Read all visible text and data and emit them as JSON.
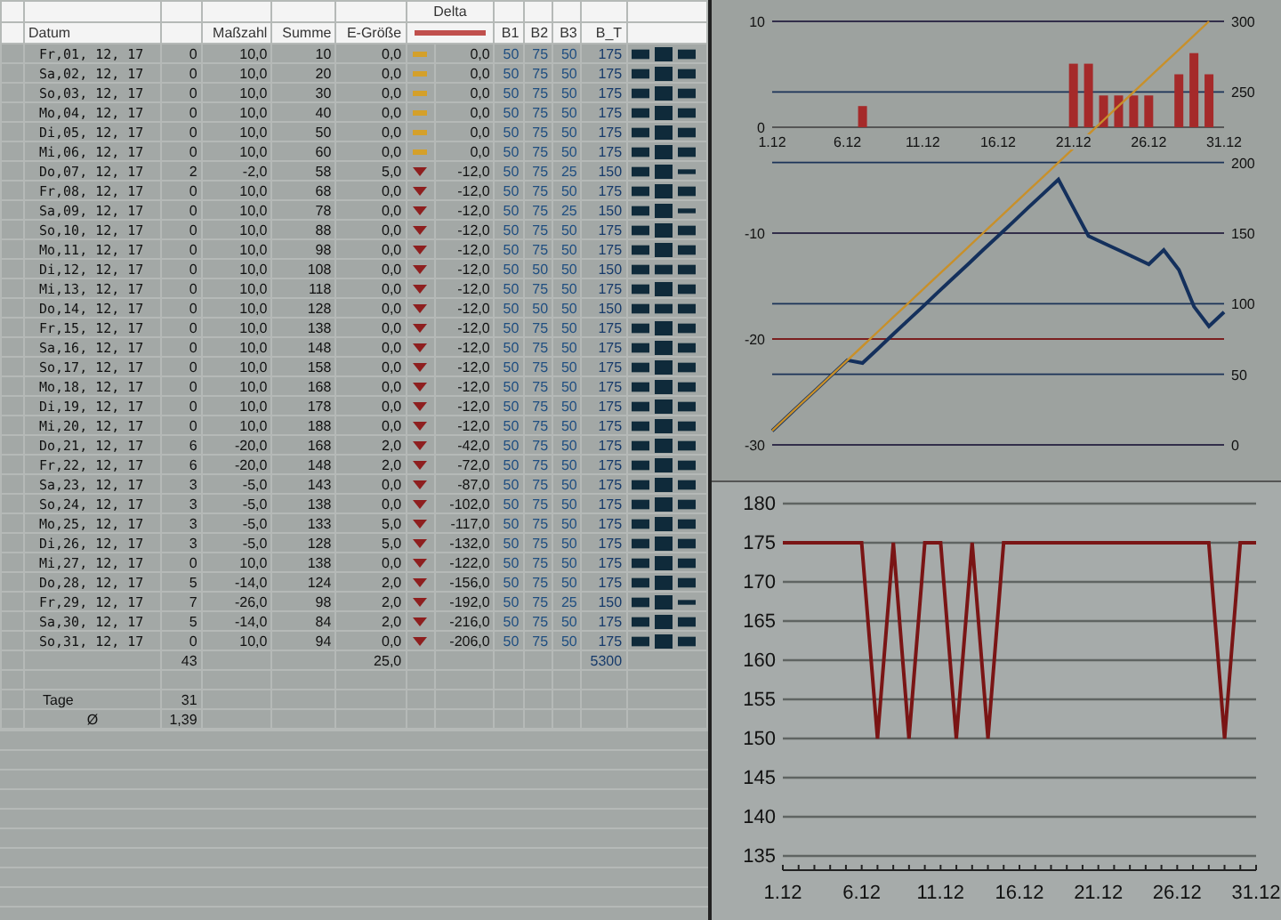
{
  "table": {
    "group_label": "Delta",
    "columns": [
      "Datum",
      "Maßzahl",
      "Summe",
      "E-Größe",
      "B1",
      "B2",
      "B3",
      "B_T"
    ],
    "rows": [
      {
        "datum": "Fr,01, 12, 17",
        "column_2": "0",
        "masszahl": "10,0",
        "summe": "10",
        "e_groesse": "0,0",
        "kind": "flat",
        "delta": "0,0",
        "b1": "50",
        "b2": "75",
        "b3": "50",
        "b_t": "175"
      },
      {
        "datum": "Sa,02, 12, 17",
        "column_2": "0",
        "masszahl": "10,0",
        "summe": "20",
        "e_groesse": "0,0",
        "kind": "flat",
        "delta": "0,0",
        "b1": "50",
        "b2": "75",
        "b3": "50",
        "b_t": "175"
      },
      {
        "datum": "So,03, 12, 17",
        "column_2": "0",
        "masszahl": "10,0",
        "summe": "30",
        "e_groesse": "0,0",
        "kind": "flat",
        "delta": "0,0",
        "b1": "50",
        "b2": "75",
        "b3": "50",
        "b_t": "175"
      },
      {
        "datum": "Mo,04, 12, 17",
        "column_2": "0",
        "masszahl": "10,0",
        "summe": "40",
        "e_groesse": "0,0",
        "kind": "flat",
        "delta": "0,0",
        "b1": "50",
        "b2": "75",
        "b3": "50",
        "b_t": "175"
      },
      {
        "datum": "Di,05, 12, 17",
        "column_2": "0",
        "masszahl": "10,0",
        "summe": "50",
        "e_groesse": "0,0",
        "kind": "flat",
        "delta": "0,0",
        "b1": "50",
        "b2": "75",
        "b3": "50",
        "b_t": "175"
      },
      {
        "datum": "Mi,06, 12, 17",
        "column_2": "0",
        "masszahl": "10,0",
        "summe": "60",
        "e_groesse": "0,0",
        "kind": "flat",
        "delta": "0,0",
        "b1": "50",
        "b2": "75",
        "b3": "50",
        "b_t": "175"
      },
      {
        "datum": "Do,07, 12, 17",
        "column_2": "2",
        "masszahl": "-2,0",
        "summe": "58",
        "e_groesse": "5,0",
        "kind": "down",
        "delta": "-12,0",
        "b1": "50",
        "b2": "75",
        "b3": "25",
        "b_t": "150"
      },
      {
        "datum": "Fr,08, 12, 17",
        "column_2": "0",
        "masszahl": "10,0",
        "summe": "68",
        "e_groesse": "0,0",
        "kind": "down",
        "delta": "-12,0",
        "b1": "50",
        "b2": "75",
        "b3": "50",
        "b_t": "175"
      },
      {
        "datum": "Sa,09, 12, 17",
        "column_2": "0",
        "masszahl": "10,0",
        "summe": "78",
        "e_groesse": "0,0",
        "kind": "down",
        "delta": "-12,0",
        "b1": "50",
        "b2": "75",
        "b3": "25",
        "b_t": "150"
      },
      {
        "datum": "So,10, 12, 17",
        "column_2": "0",
        "masszahl": "10,0",
        "summe": "88",
        "e_groesse": "0,0",
        "kind": "down",
        "delta": "-12,0",
        "b1": "50",
        "b2": "75",
        "b3": "50",
        "b_t": "175"
      },
      {
        "datum": "Mo,11, 12, 17",
        "column_2": "0",
        "masszahl": "10,0",
        "summe": "98",
        "e_groesse": "0,0",
        "kind": "down",
        "delta": "-12,0",
        "b1": "50",
        "b2": "75",
        "b3": "50",
        "b_t": "175"
      },
      {
        "datum": "Di,12, 12, 17",
        "column_2": "0",
        "masszahl": "10,0",
        "summe": "108",
        "e_groesse": "0,0",
        "kind": "down",
        "delta": "-12,0",
        "b1": "50",
        "b2": "50",
        "b3": "50",
        "b_t": "150"
      },
      {
        "datum": "Mi,13, 12, 17",
        "column_2": "0",
        "masszahl": "10,0",
        "summe": "118",
        "e_groesse": "0,0",
        "kind": "down",
        "delta": "-12,0",
        "b1": "50",
        "b2": "75",
        "b3": "50",
        "b_t": "175"
      },
      {
        "datum": "Do,14, 12, 17",
        "column_2": "0",
        "masszahl": "10,0",
        "summe": "128",
        "e_groesse": "0,0",
        "kind": "down",
        "delta": "-12,0",
        "b1": "50",
        "b2": "50",
        "b3": "50",
        "b_t": "150"
      },
      {
        "datum": "Fr,15, 12, 17",
        "column_2": "0",
        "masszahl": "10,0",
        "summe": "138",
        "e_groesse": "0,0",
        "kind": "down",
        "delta": "-12,0",
        "b1": "50",
        "b2": "75",
        "b3": "50",
        "b_t": "175"
      },
      {
        "datum": "Sa,16, 12, 17",
        "column_2": "0",
        "masszahl": "10,0",
        "summe": "148",
        "e_groesse": "0,0",
        "kind": "down",
        "delta": "-12,0",
        "b1": "50",
        "b2": "75",
        "b3": "50",
        "b_t": "175"
      },
      {
        "datum": "So,17, 12, 17",
        "column_2": "0",
        "masszahl": "10,0",
        "summe": "158",
        "e_groesse": "0,0",
        "kind": "down",
        "delta": "-12,0",
        "b1": "50",
        "b2": "75",
        "b3": "50",
        "b_t": "175"
      },
      {
        "datum": "Mo,18, 12, 17",
        "column_2": "0",
        "masszahl": "10,0",
        "summe": "168",
        "e_groesse": "0,0",
        "kind": "down",
        "delta": "-12,0",
        "b1": "50",
        "b2": "75",
        "b3": "50",
        "b_t": "175"
      },
      {
        "datum": "Di,19, 12, 17",
        "column_2": "0",
        "masszahl": "10,0",
        "summe": "178",
        "e_groesse": "0,0",
        "kind": "down",
        "delta": "-12,0",
        "b1": "50",
        "b2": "75",
        "b3": "50",
        "b_t": "175"
      },
      {
        "datum": "Mi,20, 12, 17",
        "column_2": "0",
        "masszahl": "10,0",
        "summe": "188",
        "e_groesse": "0,0",
        "kind": "down",
        "delta": "-12,0",
        "b1": "50",
        "b2": "75",
        "b3": "50",
        "b_t": "175"
      },
      {
        "datum": "Do,21, 12, 17",
        "column_2": "6",
        "masszahl": "-20,0",
        "summe": "168",
        "e_groesse": "2,0",
        "kind": "down",
        "delta": "-42,0",
        "b1": "50",
        "b2": "75",
        "b3": "50",
        "b_t": "175"
      },
      {
        "datum": "Fr,22, 12, 17",
        "column_2": "6",
        "masszahl": "-20,0",
        "summe": "148",
        "e_groesse": "2,0",
        "kind": "down",
        "delta": "-72,0",
        "b1": "50",
        "b2": "75",
        "b3": "50",
        "b_t": "175"
      },
      {
        "datum": "Sa,23, 12, 17",
        "column_2": "3",
        "masszahl": "-5,0",
        "summe": "143",
        "e_groesse": "0,0",
        "kind": "down",
        "delta": "-87,0",
        "b1": "50",
        "b2": "75",
        "b3": "50",
        "b_t": "175"
      },
      {
        "datum": "So,24, 12, 17",
        "column_2": "3",
        "masszahl": "-5,0",
        "summe": "138",
        "e_groesse": "0,0",
        "kind": "down",
        "delta": "-102,0",
        "b1": "50",
        "b2": "75",
        "b3": "50",
        "b_t": "175"
      },
      {
        "datum": "Mo,25, 12, 17",
        "column_2": "3",
        "masszahl": "-5,0",
        "summe": "133",
        "e_groesse": "5,0",
        "kind": "down",
        "delta": "-117,0",
        "b1": "50",
        "b2": "75",
        "b3": "50",
        "b_t": "175"
      },
      {
        "datum": "Di,26, 12, 17",
        "column_2": "3",
        "masszahl": "-5,0",
        "summe": "128",
        "e_groesse": "5,0",
        "kind": "down",
        "delta": "-132,0",
        "b1": "50",
        "b2": "75",
        "b3": "50",
        "b_t": "175"
      },
      {
        "datum": "Mi,27, 12, 17",
        "column_2": "0",
        "masszahl": "10,0",
        "summe": "138",
        "e_groesse": "0,0",
        "kind": "down",
        "delta": "-122,0",
        "b1": "50",
        "b2": "75",
        "b3": "50",
        "b_t": "175"
      },
      {
        "datum": "Do,28, 12, 17",
        "column_2": "5",
        "masszahl": "-14,0",
        "summe": "124",
        "e_groesse": "2,0",
        "kind": "down",
        "delta": "-156,0",
        "b1": "50",
        "b2": "75",
        "b3": "50",
        "b_t": "175"
      },
      {
        "datum": "Fr,29, 12, 17",
        "column_2": "7",
        "masszahl": "-26,0",
        "summe": "98",
        "e_groesse": "2,0",
        "kind": "down",
        "delta": "-192,0",
        "b1": "50",
        "b2": "75",
        "b3": "25",
        "b_t": "150"
      },
      {
        "datum": "Sa,30, 12, 17",
        "column_2": "5",
        "masszahl": "-14,0",
        "summe": "84",
        "e_groesse": "2,0",
        "kind": "down",
        "delta": "-216,0",
        "b1": "50",
        "b2": "75",
        "b3": "50",
        "b_t": "175"
      },
      {
        "datum": "So,31, 12, 17",
        "column_2": "0",
        "masszahl": "10,0",
        "summe": "94",
        "e_groesse": "0,0",
        "kind": "down",
        "delta": "-206,0",
        "b1": "50",
        "b2": "75",
        "b3": "50",
        "b_t": "175"
      }
    ],
    "totals": {
      "column_2": "43",
      "e_groesse": "25,0",
      "b_t": "5300"
    },
    "stats": [
      {
        "label": "Tage",
        "value": "31"
      },
      {
        "label": "Ø",
        "value": "1,39"
      }
    ]
  },
  "top_chart": {
    "chart_data": {
      "type": "bar",
      "grid": true,
      "categories": [
        "1.12",
        null,
        null,
        null,
        null,
        "6.12",
        null,
        null,
        null,
        null,
        "11.12",
        null,
        null,
        null,
        null,
        "16.12",
        null,
        null,
        null,
        null,
        "21.12",
        null,
        null,
        null,
        null,
        "26.12",
        null,
        null,
        null,
        null,
        "31.12"
      ],
      "ylim": [
        -30,
        10
      ],
      "yticks": [
        -30,
        -20,
        -10,
        0,
        10
      ],
      "y2lim": [
        0,
        300
      ],
      "y2ticks": [
        0,
        50,
        100,
        150,
        200,
        250,
        300
      ],
      "series": [
        {
          "color": "#a52a2a",
          "values": [
            0,
            0,
            0,
            0,
            0,
            0,
            2,
            0,
            0,
            0,
            0,
            0,
            0,
            0,
            0,
            0,
            0,
            0,
            0,
            0,
            6,
            6,
            3,
            3,
            3,
            3,
            0,
            5,
            7,
            5,
            0
          ]
        },
        {
          "type": "line",
          "axis": "y2",
          "color": "#14305c",
          "values": [
            10,
            20,
            30,
            40,
            50,
            60,
            58,
            68,
            78,
            88,
            98,
            108,
            118,
            128,
            138,
            148,
            158,
            168,
            178,
            188,
            168,
            148,
            143,
            138,
            133,
            128,
            138,
            124,
            98,
            84,
            94
          ]
        },
        {
          "type": "line",
          "axis": "y2",
          "color": "#c8902a",
          "values": [
            10,
            20,
            30,
            40,
            50,
            60,
            70,
            80,
            90,
            100,
            110,
            120,
            130,
            140,
            150,
            160,
            170,
            180,
            190,
            200,
            210,
            220,
            230,
            240,
            250,
            260,
            270,
            280,
            290,
            300,
            null
          ]
        }
      ]
    }
  },
  "bottom_chart": {
    "chart_data": {
      "type": "line",
      "grid": true,
      "categories": [
        "1.12",
        null,
        null,
        null,
        null,
        "6.12",
        null,
        null,
        null,
        null,
        "11.12",
        null,
        null,
        null,
        null,
        "16.12",
        null,
        null,
        null,
        null,
        "21.12",
        null,
        null,
        null,
        null,
        "26.12",
        null,
        null,
        null,
        null,
        "31.12"
      ],
      "ylim": [
        135,
        180
      ],
      "yticks": [
        135,
        140,
        145,
        150,
        155,
        160,
        165,
        170,
        175,
        180
      ],
      "series": [
        {
          "color": "#7a1515",
          "values": [
            175,
            175,
            175,
            175,
            175,
            175,
            150,
            175,
            150,
            175,
            175,
            150,
            175,
            150,
            175,
            175,
            175,
            175,
            175,
            175,
            175,
            175,
            175,
            175,
            175,
            175,
            175,
            175,
            150,
            175,
            175
          ]
        }
      ]
    }
  }
}
